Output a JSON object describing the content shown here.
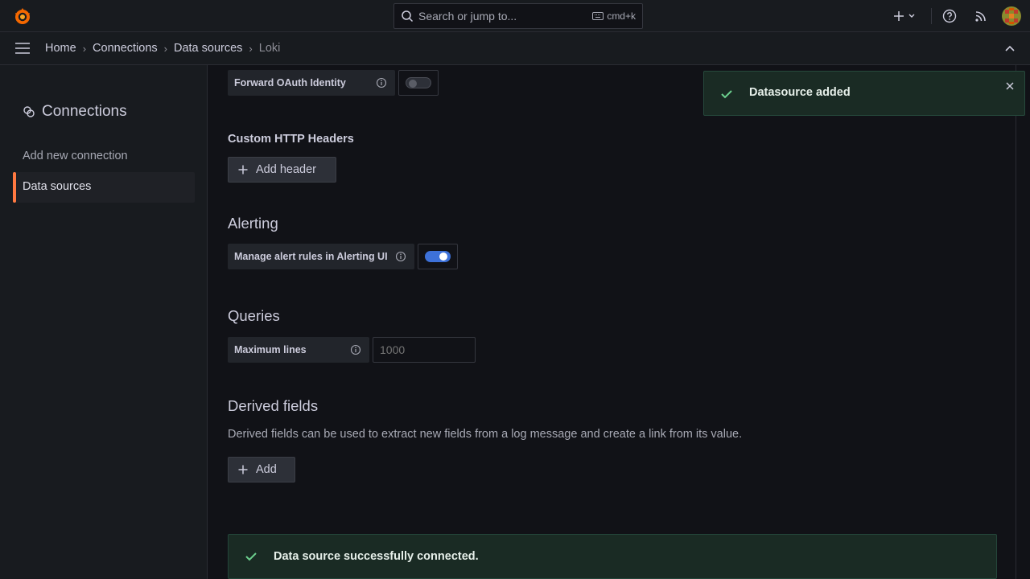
{
  "topbar": {
    "search_placeholder": "Search or jump to...",
    "search_shortcut": "cmd+k"
  },
  "breadcrumb": {
    "items": [
      "Home",
      "Connections",
      "Data sources",
      "Loki"
    ]
  },
  "sidebar": {
    "title": "Connections",
    "items": [
      {
        "label": "Add new connection",
        "active": false
      },
      {
        "label": "Data sources",
        "active": true
      }
    ]
  },
  "form": {
    "forward_oauth": {
      "label": "Forward OAuth Identity",
      "enabled": false
    },
    "custom_headers": {
      "title": "Custom HTTP Headers",
      "button": "Add header"
    },
    "alerting": {
      "title": "Alerting",
      "manage_rules_label": "Manage alert rules in Alerting UI",
      "enabled": true
    },
    "queries": {
      "title": "Queries",
      "max_lines_label": "Maximum lines",
      "max_lines_placeholder": "1000"
    },
    "derived_fields": {
      "title": "Derived fields",
      "description": "Derived fields can be used to extract new fields from a log message and create a link from its value.",
      "button": "Add"
    }
  },
  "banner": {
    "message": "Data source successfully connected."
  },
  "toast": {
    "message": "Datasource added"
  },
  "colors": {
    "accent": "#ff7941",
    "switch_on": "#3d71d9",
    "success": "#6ccf8e"
  }
}
